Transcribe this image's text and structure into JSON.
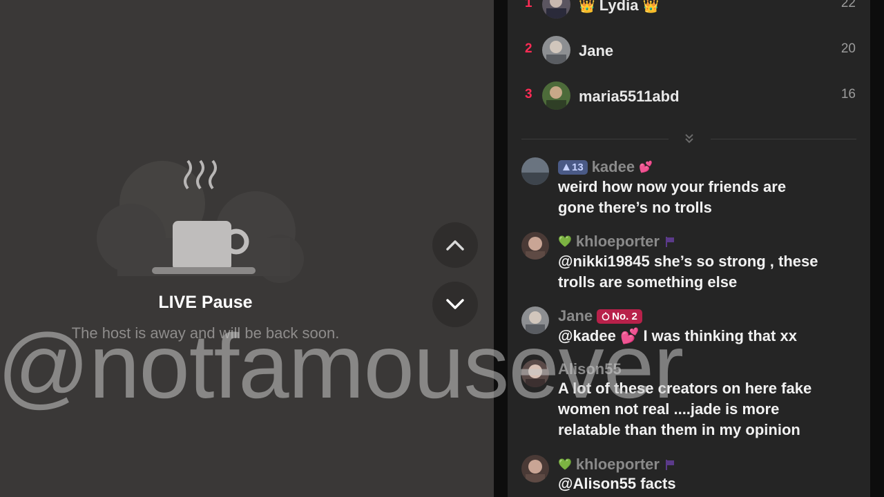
{
  "pause": {
    "title": "LIVE Pause",
    "subtitle": "The host is away and will be back soon."
  },
  "nav": {
    "up_icon": "chevron-up-icon",
    "down_icon": "chevron-down-icon"
  },
  "leaderboard": [
    {
      "rank": "1",
      "name": "Lydia",
      "score": "22",
      "crown_left": "👑",
      "crown_right": "👑"
    },
    {
      "rank": "2",
      "name": "Jane",
      "score": "20"
    },
    {
      "rank": "3",
      "name": "maria5511abd",
      "score": "16"
    }
  ],
  "messages": [
    {
      "name": "kadee",
      "level": "13",
      "heart": "💕",
      "text_lines": [
        "weird how now your friends are",
        "gone there’s no trolls"
      ]
    },
    {
      "name": "khloeporter",
      "prefix": "💚",
      "text_lines": [
        "@nikki19845 she’s so strong , these",
        "trolls are something else"
      ]
    },
    {
      "name": "Jane",
      "rank_badge": "No. 2",
      "text": "@kadee 💕 I was thinking that xx"
    },
    {
      "name": "Alison55",
      "text_lines": [
        "A lot of these creators on here fake",
        "women not real ....jade is more",
        "relatable than them in my opinion"
      ]
    },
    {
      "name": "khloeporter",
      "prefix": "💚",
      "text": "@Alison55 facts"
    }
  ],
  "watermark": "@notfamousever",
  "colors": {
    "accent": "#fe2c55",
    "panel_bg": "#252525",
    "player_bg": "#3a3837"
  }
}
